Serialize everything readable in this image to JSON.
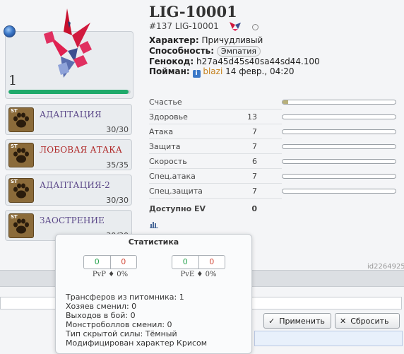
{
  "pokemon": {
    "name": "LIG-10001",
    "number_line": "#137 LIG-10001",
    "level": "1",
    "hp_fraction": 0.98,
    "character_label": "Характер:",
    "character_value": "Причудливый",
    "ability_label": "Способность:",
    "ability_value": "Эмпатия",
    "genocode_label": "Генокод:",
    "genocode_value": "h27a45d45s40sa44sd44.100",
    "caught_label": "Пойман:",
    "caught_user": "blazi",
    "caught_date": "14 февр., 04:20",
    "info_icon": "i"
  },
  "moves": [
    {
      "name": "АДАПТАЦИЯ",
      "pp": "30/30",
      "icon": "paw-icon",
      "badge": "ST"
    },
    {
      "name": "ЛОБОВАЯ АТАКА",
      "pp": "35/35",
      "icon": "paw-icon",
      "badge": "ST"
    },
    {
      "name": "АДАПТАЦИЯ-2",
      "pp": "30/30",
      "icon": "paw-icon",
      "badge": "ST"
    },
    {
      "name": "ЗАОСТРЕНИЕ",
      "pp": "30/30",
      "icon": "paw-icon",
      "badge": "ST"
    }
  ],
  "stats": [
    {
      "label": "Счастье",
      "value": "",
      "fill": 0.05
    },
    {
      "label": "Здоровье",
      "value": "13",
      "fill": 0
    },
    {
      "label": "Атака",
      "value": "7",
      "fill": 0
    },
    {
      "label": "Защита",
      "value": "7",
      "fill": 0
    },
    {
      "label": "Скорость",
      "value": "6",
      "fill": 0
    },
    {
      "label": "Спец.атака",
      "value": "7",
      "fill": 0
    },
    {
      "label": "Спец.защита",
      "value": "7",
      "fill": 0
    }
  ],
  "ev": {
    "label": "Доступно EV",
    "value": "0"
  },
  "page_id": "id2264925",
  "buttons": {
    "apply": "Применить",
    "reset": "Сбросить"
  },
  "tooltip": {
    "title": "Статистика",
    "pvp": {
      "wins": "0",
      "losses": "0",
      "label": "PvP",
      "sep": "♦",
      "percent": "0%"
    },
    "pve": {
      "wins": "0",
      "losses": "0",
      "label": "PvE",
      "sep": "♦",
      "percent": "0%"
    },
    "lines": [
      "Трансферов из питомника: 1",
      "Хозяев сменил: 0",
      "Выходов в бой: 0",
      "Монстроболлов сменил: 0",
      "Тип скрытой силы: Тёмный",
      "Модифицирован характер Крисом"
    ]
  },
  "colors": {
    "hp": "#1faa6b",
    "win": "#27a34e",
    "loss": "#d24a3a",
    "user": "#c47f1a"
  }
}
